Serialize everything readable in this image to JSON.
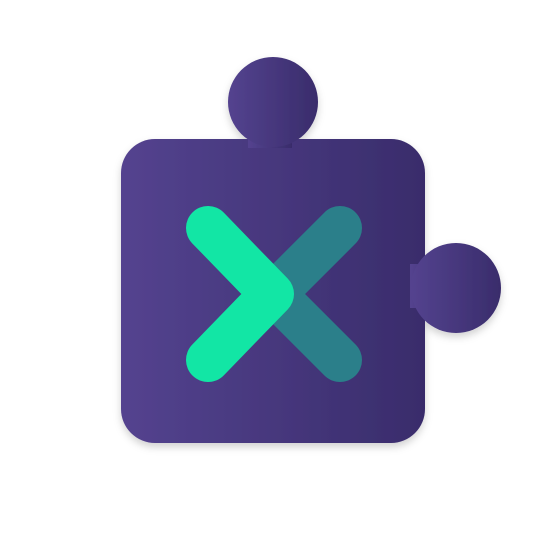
{
  "app_icon": {
    "icon_name": "puzzle-piece-extension-icon",
    "mark_icon_name": "x-mark-icon",
    "colors": {
      "background": "#ffffff",
      "puzzle_gradient_start": "#54438f",
      "puzzle_gradient_end": "#392c6b",
      "mark_front": "#12e6a5",
      "mark_back": "#2b7f8a",
      "shadow": "#000000"
    }
  }
}
